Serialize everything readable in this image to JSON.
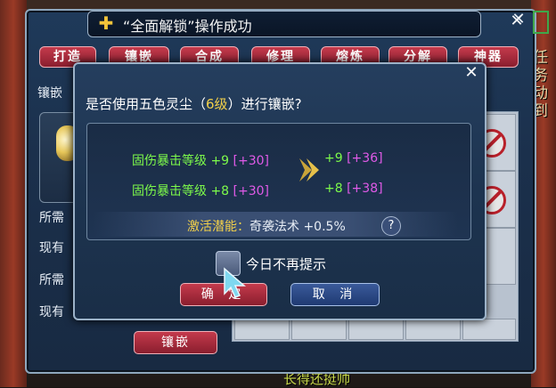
{
  "background": {
    "right_edge_text": "任务 动 到",
    "bottom_text": "长得还挺帅"
  },
  "forge_panel": {
    "title": "镶嵌",
    "tabs": [
      "打造",
      "镶嵌",
      "合成",
      "修理",
      "熔炼",
      "分解",
      "神器"
    ],
    "side_labels": [
      "镶嵌",
      "所需",
      "现有",
      "所需",
      "现有"
    ],
    "inlay_button": "镶嵌"
  },
  "notification": {
    "text": "“全面解锁”操作成功",
    "icon": "plus-cross-icon"
  },
  "dialog": {
    "question_prefix": "是否使用五色灵尘（",
    "question_level": "6级",
    "question_suffix": "）进行镶嵌?",
    "stats": [
      {
        "name": "固伤暴击等级",
        "base": "+9",
        "bonus_before": "[+30]",
        "after_base": "+9",
        "bonus_after": "[+36]"
      },
      {
        "name": "固伤暴击等级",
        "base": "+8",
        "bonus_before": "[+30]",
        "after_base": "+8",
        "bonus_after": "[+38]"
      }
    ],
    "activate_label": "激活潜能：",
    "activate_value": "奇袭法术 +0.5%",
    "help_label": "?",
    "checkbox_label": "今日不再提示",
    "ok_button": "确 定",
    "cancel_button": "取 消"
  },
  "colors": {
    "stat_name": "#7dfa4a",
    "bonus": "#e05ae8",
    "highlight": "#f2d04a",
    "confirm_button": "#c43a4c",
    "cancel_button": "#1f3a72"
  }
}
